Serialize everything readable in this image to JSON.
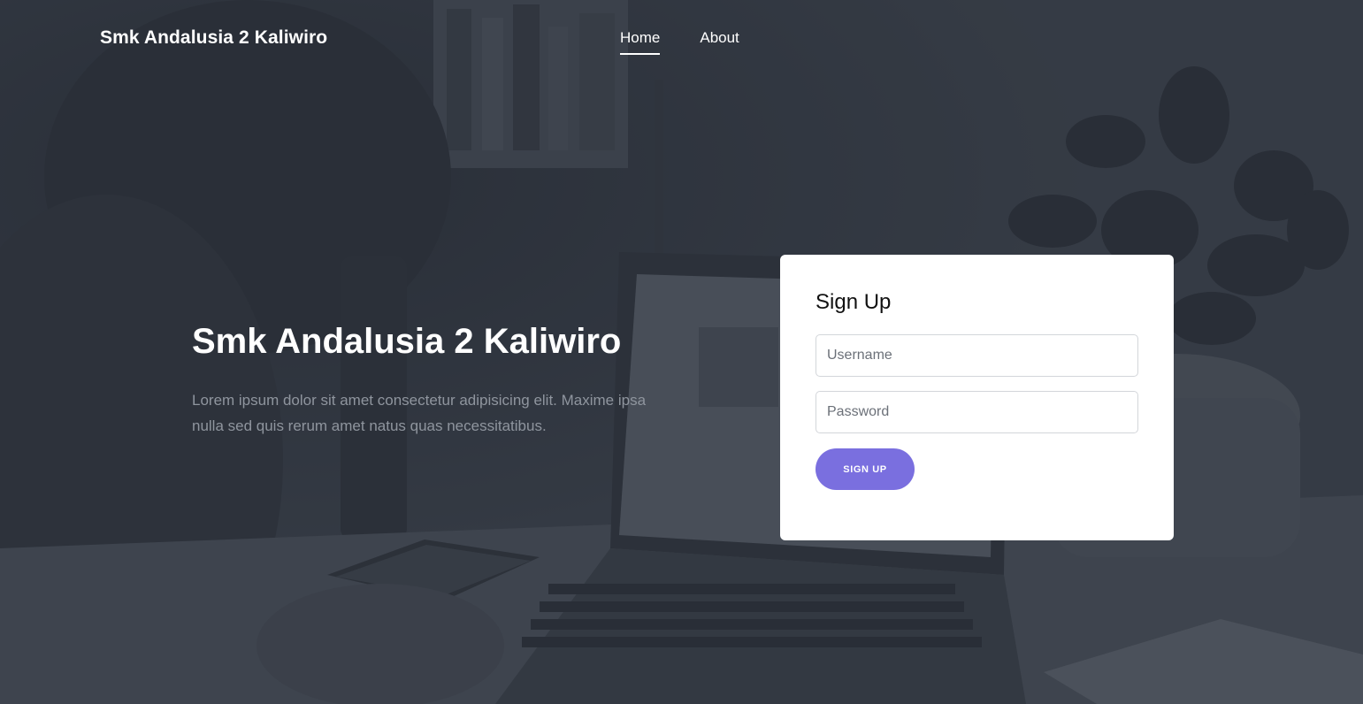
{
  "navbar": {
    "brand": "Smk Andalusia 2 Kaliwiro",
    "links": [
      {
        "label": "Home",
        "active": true
      },
      {
        "label": "About",
        "active": false
      }
    ]
  },
  "hero": {
    "title": "Smk Andalusia 2 Kaliwiro",
    "description": "Lorem ipsum dolor sit amet consectetur adipisicing elit. Maxime ipsa nulla sed quis rerum amet natus quas necessitatibus."
  },
  "signup": {
    "title": "Sign Up",
    "username_placeholder": "Username",
    "username_value": "",
    "password_placeholder": "Password",
    "password_value": "",
    "button_label": "SIGN UP"
  },
  "colors": {
    "accent": "#7a6fdf",
    "background": "#3c424b",
    "card": "#ffffff"
  }
}
